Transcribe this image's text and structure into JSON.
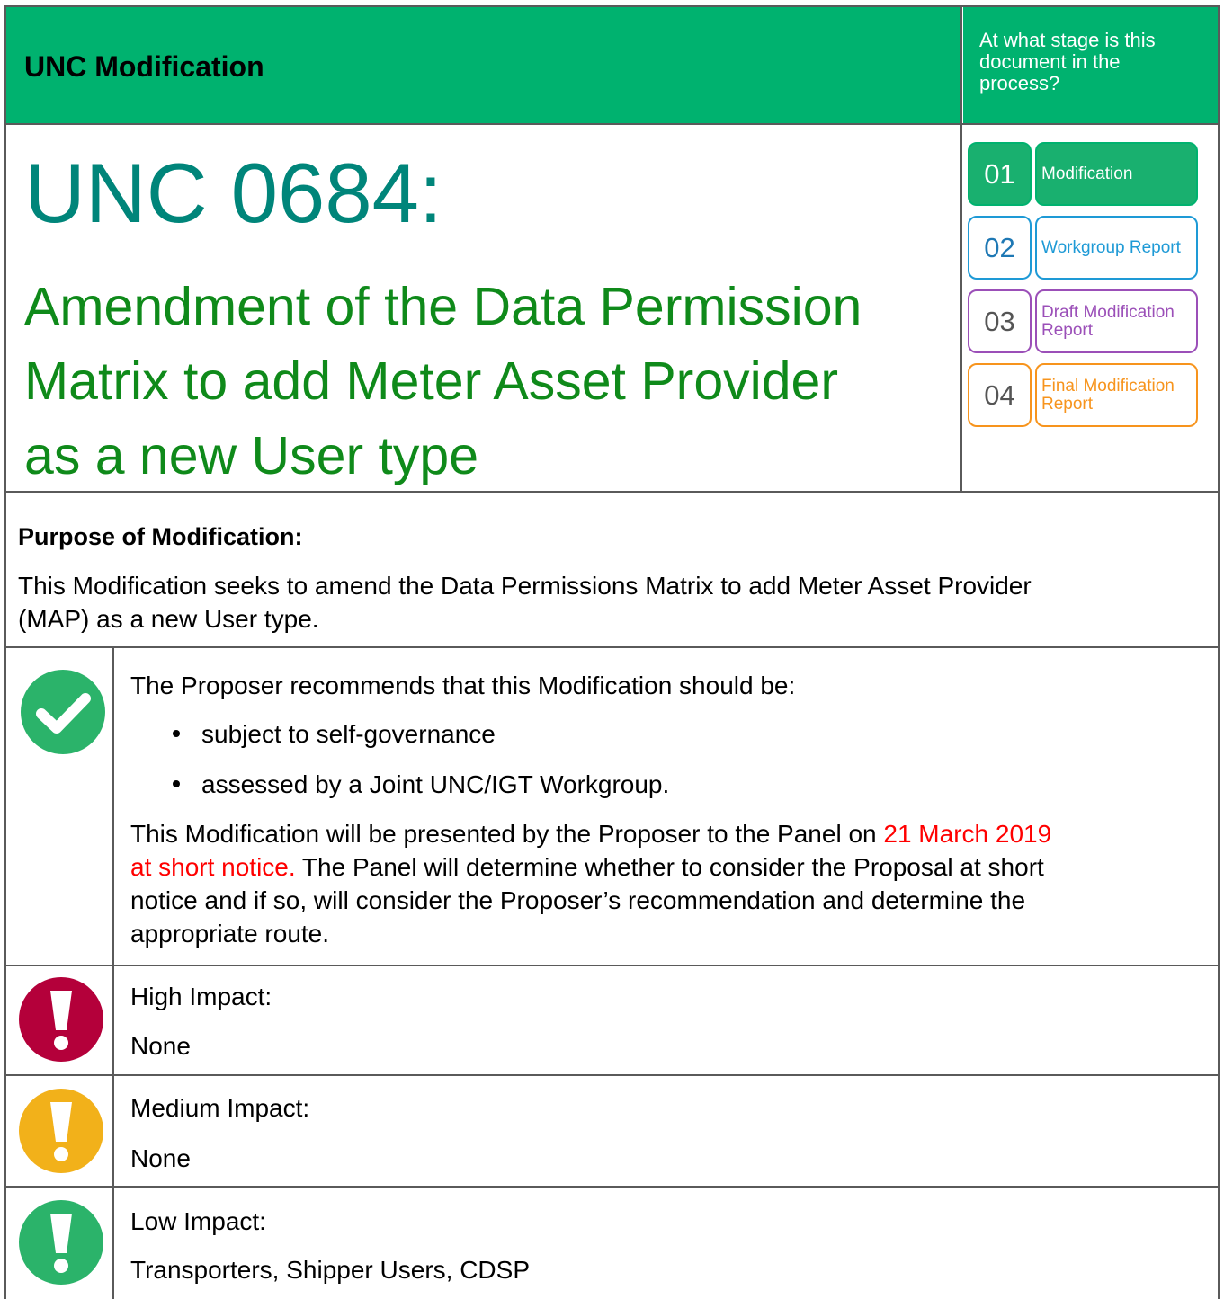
{
  "header": {
    "title": "UNC Modification",
    "stage_question": "At what stage is this document in the process?"
  },
  "title": {
    "main": "UNC 0684:",
    "sub_lines": [
      "Amendment of the Data Permission",
      "Matrix to add Meter Asset Provider",
      "as a new User type"
    ]
  },
  "stages": [
    {
      "number": "01",
      "label": "Modification",
      "color": "#00b26f",
      "active": true
    },
    {
      "number": "02",
      "label": "Workgroup Report",
      "color": "#1e9ad6",
      "active": false
    },
    {
      "number": "03",
      "label": "Draft Modification Report",
      "color": "#9b4fb8",
      "active": false
    },
    {
      "number": "04",
      "label": "Final Modification Report",
      "color": "#f7941d",
      "active": false
    }
  ],
  "purpose": {
    "heading": "Purpose of Modification:",
    "line1": "This Modification seeks to amend the Data Permissions Matrix to add Meter Asset Provider",
    "line2": "(MAP) as a new User type."
  },
  "recommendation": {
    "icon": "check-circle-icon",
    "color": "#2bb36a",
    "intro": "The Proposer recommends that this Modification should be:",
    "bullets": [
      "subject to self-governance",
      "assessed by a Joint UNC/IGT Workgroup."
    ],
    "para_line1_a": "This Modification will be presented by the Proposer to the Panel on ",
    "para_line1_red": "21 March 2019",
    "para_line2_red": "at short notice.",
    "para_line2_b": " The Panel will determine whether to consider the Proposal at short",
    "para_line3": "notice and if so, will consider the Proposer’s recommendation and determine the",
    "para_line4": "appropriate route."
  },
  "impacts": [
    {
      "icon": "exclamation-high-icon",
      "color": "#b4003a",
      "label": "High Impact:",
      "value": "None"
    },
    {
      "icon": "exclamation-medium-icon",
      "color": "#f2b11a",
      "label": "Medium Impact:",
      "value": "None"
    },
    {
      "icon": "exclamation-low-icon",
      "color": "#2bb36a",
      "label": "Low Impact:",
      "value": "Transporters, Shipper Users, CDSP"
    }
  ]
}
